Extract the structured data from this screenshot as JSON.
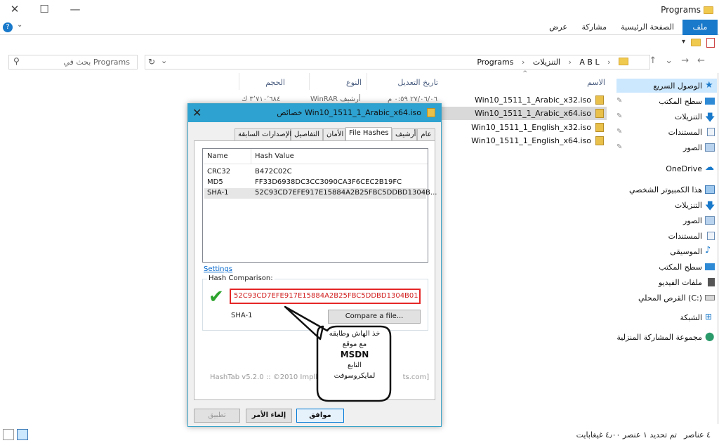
{
  "window": {
    "title": "Programs"
  },
  "ribbon": {
    "tabs": [
      "ملف",
      "الصفحة الرئيسية",
      "مشاركة",
      "عرض"
    ],
    "help_icon": "help-icon"
  },
  "address": {
    "breadcrumb": [
      "A B L",
      "التنزيلات",
      "Programs"
    ],
    "search_placeholder": "بحث في Programs"
  },
  "columns": {
    "name": "الاسم",
    "date": "تاريخ التعديل",
    "type": "النوع",
    "size": "الحجم"
  },
  "files": [
    {
      "name": "Win10_1511_1_Arabic_x32.iso",
      "selected": false,
      "date": "",
      "type": "",
      "size": ""
    },
    {
      "name": "Win10_1511_1_Arabic_x64.iso",
      "selected": true,
      "date": "٢٧/٠٦/٠٦ ٠:٥٩ م",
      "type": "WinRAR أرشيف",
      "size": "٣٬٧١٠٬٦٨٤ ك"
    },
    {
      "name": "Win10_1511_1_English_x32.iso",
      "selected": false,
      "date": "",
      "type": "",
      "size": ""
    },
    {
      "name": "Win10_1511_1_English_x64.iso",
      "selected": false,
      "date": "",
      "type": "",
      "size": ""
    }
  ],
  "nav": {
    "quick_access": "الوصول السريع",
    "quick_items": [
      "سطح المكتب",
      "التنزيلات",
      "المستندات",
      "الصور"
    ],
    "onedrive": "OneDrive",
    "this_pc": "هذا الكمبيوتر الشخصي",
    "pc_items": [
      "التنزيلات",
      "الصور",
      "المستندات",
      "الموسيقى",
      "سطح المكتب",
      "ملفات الفيديو",
      "القرص المحلي (C:)"
    ],
    "network": "الشبكة",
    "homegroup": "مجموعة المشاركة المنزلية"
  },
  "status": {
    "count": "٤ عناصر",
    "selection": "تم تحديد ١ عنصر ٤٫٠٠ غيغابايت"
  },
  "dialog": {
    "title": "خصائص Win10_1511_1_Arabic_x64.iso",
    "tabs": [
      "عام",
      "أرشيف",
      "File Hashes",
      "الأمان",
      "التفاصيل",
      "الإصدارات السابقة"
    ],
    "active_tab": "File Hashes",
    "list_headers": {
      "name": "Name",
      "value": "Hash Value"
    },
    "hashes": [
      {
        "name": "CRC32",
        "value": "B472C02C"
      },
      {
        "name": "MD5",
        "value": "FF33D6938DC3CC3090CA3F6CEC2B19FC"
      },
      {
        "name": "SHA-1",
        "value": "52C93CD7EFE917E15884A2B25FBC5DDBD1304B..."
      }
    ],
    "settings_link": "Settings",
    "comparison_label": "Hash Comparison:",
    "comparison_value": "52C93CD7EFE917E15884A2B25FBC5DDBD1304B01",
    "algorithm": "SHA-1",
    "compare_button": "Compare a file...",
    "credit": "HashTab v5.2.0 :: ©2010 Implb",
    "credit_tail": "ts.com]",
    "buttons": {
      "ok": "موافق",
      "cancel": "إلغاء الأمر",
      "apply": "تطبيق"
    }
  },
  "callout": {
    "line1": "خذ الهاش وطابقه",
    "line2": "مع موقع",
    "line3": "MSDN",
    "line4": "التابع",
    "line5": "لمايكروسوفت"
  },
  "colors": {
    "accent": "#1979ca",
    "dialog_title": "#2ea2d0",
    "match_border": "#e52626",
    "check": "#2da42d"
  }
}
